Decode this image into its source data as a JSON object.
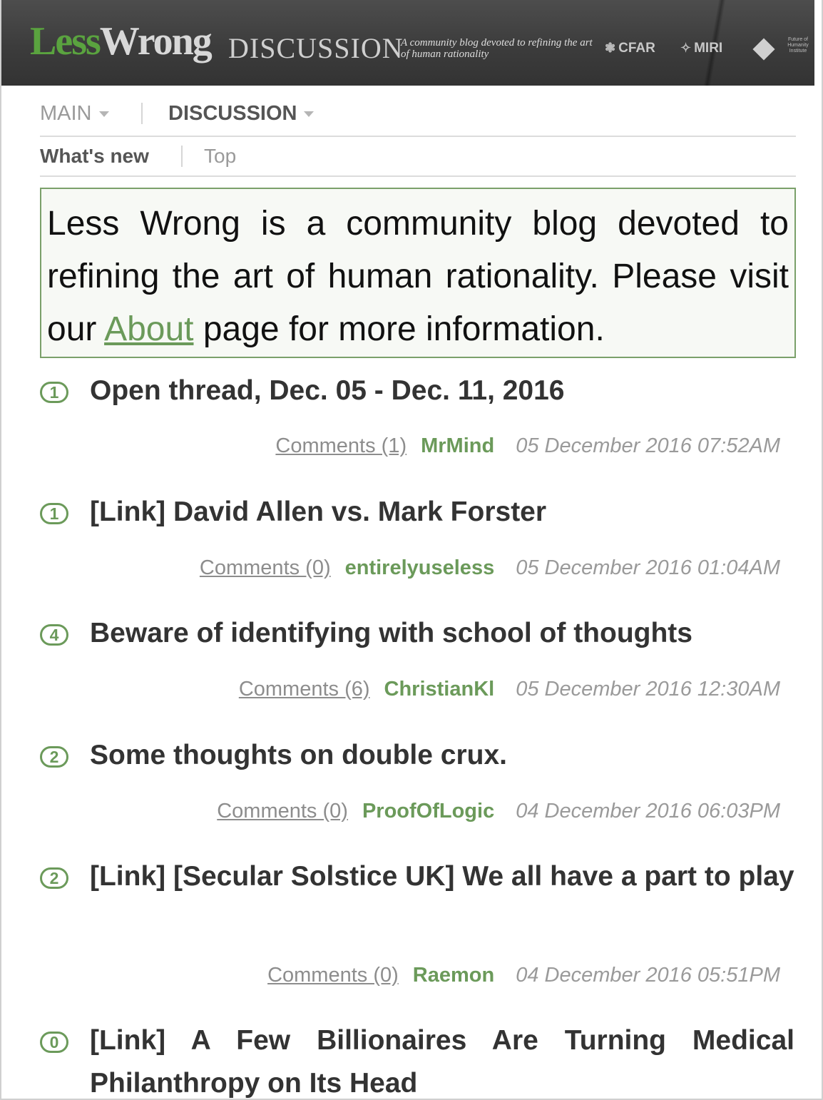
{
  "header": {
    "logo_less": "Less",
    "logo_wrong": "Wrong",
    "section": "DISCUSSION",
    "tagline": "A community blog devoted to refining the art of human rationality",
    "partners": [
      {
        "label": "CFAR",
        "icon": "cfar-icon"
      },
      {
        "label": "MIRI",
        "icon": "miri-icon"
      }
    ],
    "fhi_text": "Future of Humanity Institute"
  },
  "nav": {
    "main": "MAIN",
    "discussion": "DISCUSSION",
    "whats_new": "What's new",
    "top": "Top"
  },
  "intro": {
    "text_before": "Less Wrong is a community blog devoted to refining the art of human rationality. Please visit our ",
    "link": "About",
    "text_after": " page for more information."
  },
  "posts": [
    {
      "score": "1",
      "title": "Open thread, Dec. 05 - Dec. 11, 2016",
      "comments": "Comments (1)",
      "author": "MrMind",
      "date": "05 December 2016 07:52AM"
    },
    {
      "score": "1",
      "title": "[Link] David Allen vs. Mark Forster",
      "comments": "Comments (0)",
      "author": "entirelyuseless",
      "date": "05 December 2016 01:04AM"
    },
    {
      "score": "4",
      "title": "Beware of identifying with school of thoughts",
      "comments": "Comments (6)",
      "author": "ChristianKl",
      "date": "05 December 2016 12:30AM"
    },
    {
      "score": "2",
      "title": "Some thoughts on double crux.",
      "comments": "Comments (0)",
      "author": "ProofOfLogic",
      "date": "04 December 2016 06:03PM"
    },
    {
      "score": "2",
      "title": "[Link] [Secular Solstice UK] We all have a part to play",
      "comments": "Comments (0)",
      "author": "Raemon",
      "date": "04 December 2016 05:51PM"
    },
    {
      "score": "0",
      "title": "[Link] A Few Billionaires Are Turning Medical Philanthropy on Its Head",
      "comments": "",
      "author": "",
      "date": ""
    }
  ]
}
